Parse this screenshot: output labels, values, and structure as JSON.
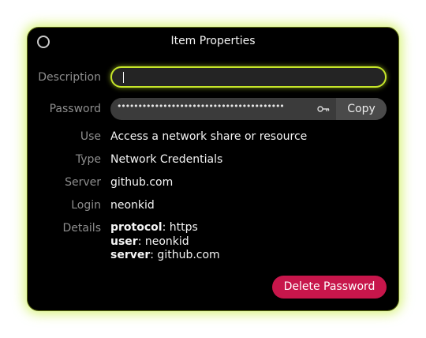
{
  "dialog": {
    "title": "Item Properties"
  },
  "labels": {
    "description": "Description",
    "password": "Password",
    "use": "Use",
    "type": "Type",
    "server": "Server",
    "login": "Login",
    "details": "Details"
  },
  "fields": {
    "description_value": "",
    "password_masked": "••••••••••••••••••••••••••••••••••••••••",
    "use": "Access a network share or resource",
    "type": "Network Credentials",
    "server": "github.com",
    "login": "neonkid"
  },
  "details": [
    {
      "key": "protocol",
      "value": ": https"
    },
    {
      "key": "user",
      "value": ": neonkid"
    },
    {
      "key": "server",
      "value": ": github.com"
    }
  ],
  "buttons": {
    "copy": "Copy",
    "delete": "Delete Password"
  },
  "colors": {
    "focus_accent": "#c6e62a",
    "destructive": "#c7164b",
    "background": "#000000"
  },
  "icons": {
    "close": "circle-close-icon",
    "reveal": "key-icon"
  }
}
